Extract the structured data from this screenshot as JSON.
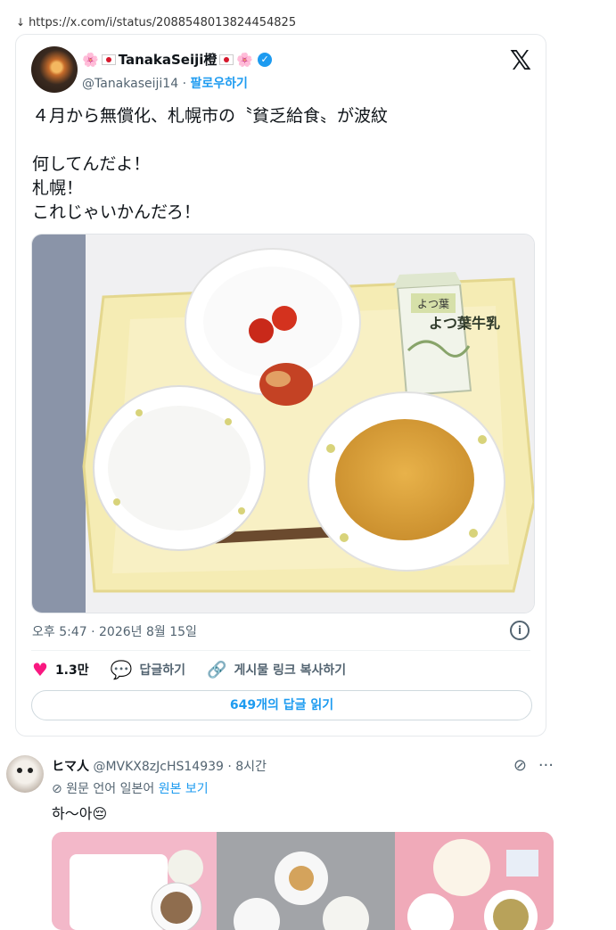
{
  "url_bar": {
    "arrow": "↓",
    "url": "https://x.com/i/status/2088548013824454825"
  },
  "tweet": {
    "flower": "🌸",
    "name": "TanakaSeiji橙",
    "handle": "@Tanakaseiji14",
    "separator": "·",
    "follow_label": "팔로우하기",
    "text_lines": [
      "４月から無償化、札幌市の〝貧乏給食〟が波紋",
      "",
      "何してんだよ！",
      "札幌！",
      "これじゃいかんだろ！"
    ],
    "photo": {
      "milk_brand": "よつ葉牛乳",
      "milk_top": "よつ葉"
    },
    "timestamp": "오후 5:47 · 2026년 8월 15일",
    "like_count": "1.3만",
    "reply_label": "답글하기",
    "copy_link_label": "게시물 링크 복사하기",
    "read_replies_label": "649개의 답글 읽기"
  },
  "reply": {
    "name": "ヒマ人",
    "handle": "@MVKX8zJcHS14939",
    "time": "· 8시간",
    "translate_text": "원문 언어 일본어",
    "view_original": "원본 보기",
    "text": "하〜아😔",
    "more": "···"
  },
  "colors": {
    "accent": "#1d9bf0",
    "like": "#f91880",
    "muted": "#536471",
    "tray": "#f5ecb4"
  },
  "icons": [
    "x-logo-icon",
    "verified-badge-icon",
    "info-icon",
    "heart-icon",
    "reply-bubble-icon",
    "link-icon",
    "grok-icon",
    "more-icon",
    "translate-icon"
  ]
}
